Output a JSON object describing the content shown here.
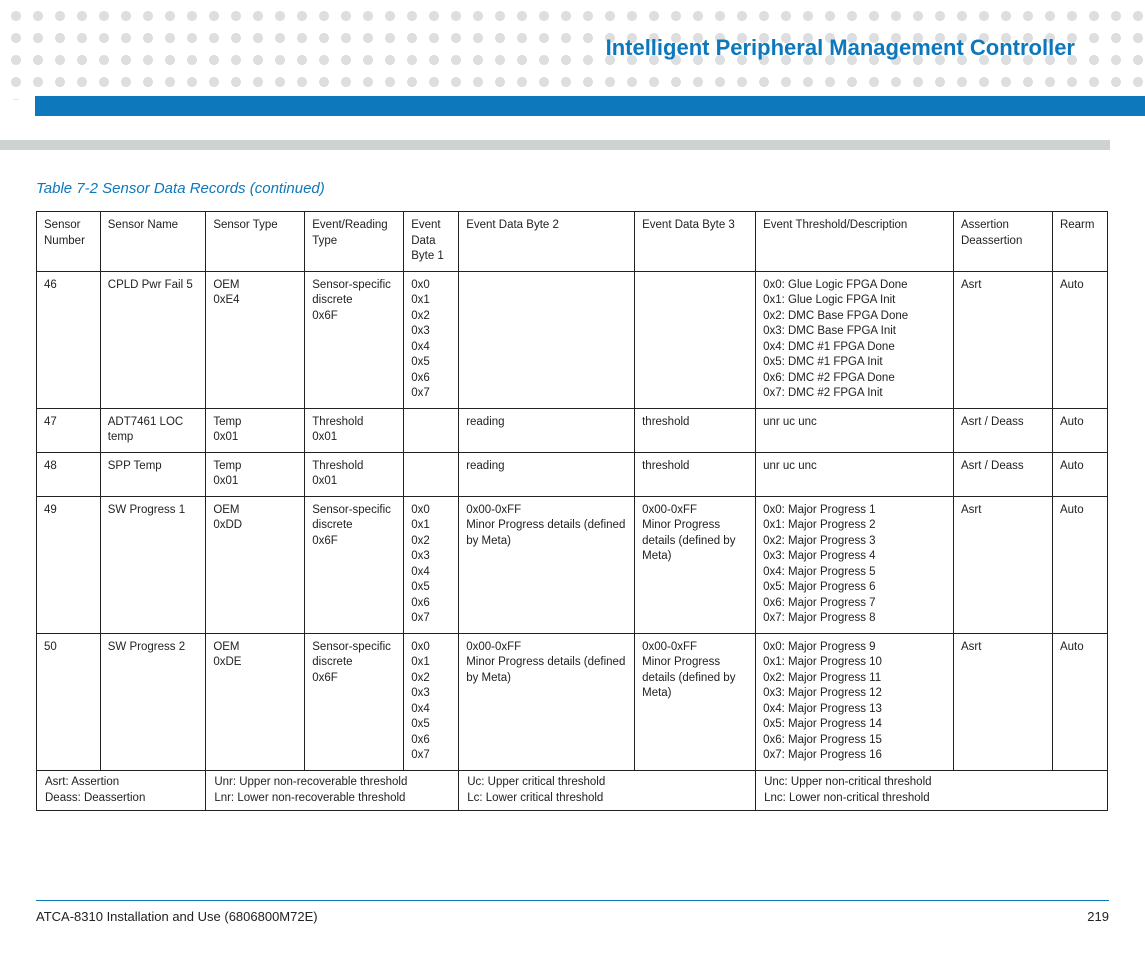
{
  "header": {
    "title": "Intelligent Peripheral Management Controller"
  },
  "caption": "Table 7-2 Sensor Data Records (continued)",
  "columns": [
    "Sensor Number",
    "Sensor Name",
    "Sensor Type",
    "Event/Reading Type",
    "Event Data Byte 1",
    "Event Data Byte 2",
    "Event Data Byte 3",
    "Event Threshold/Description",
    "Assertion Deassertion",
    "Rearm"
  ],
  "rows": [
    {
      "num": "46",
      "name": "CPLD Pwr Fail 5",
      "type": "OEM\n0xE4",
      "ert": "Sensor-specific discrete\n0x6F",
      "b1": "0x0\n0x1\n0x2\n0x3\n0x4\n0x5\n0x6\n0x7",
      "b2": "",
      "b3": "",
      "thresh": "0x0: Glue Logic FPGA Done\n0x1: Glue Logic FPGA Init\n0x2: DMC Base FPGA Done\n0x3: DMC Base FPGA Init\n0x4: DMC #1 FPGA Done\n0x5: DMC #1 FPGA Init\n0x6: DMC #2 FPGA Done\n0x7: DMC #2 FPGA Init",
      "assert": "Asrt",
      "rearm": "Auto"
    },
    {
      "num": "47",
      "name": "ADT7461 LOC temp",
      "type": "Temp\n0x01",
      "ert": "Threshold\n0x01",
      "b1": "",
      "b2": "reading",
      "b3": "threshold",
      "thresh": "unr uc unc",
      "assert": "Asrt / Deass",
      "rearm": "Auto"
    },
    {
      "num": "48",
      "name": "SPP Temp",
      "type": "Temp\n0x01",
      "ert": "Threshold\n0x01",
      "b1": "",
      "b2": "reading",
      "b3": "threshold",
      "thresh": "unr uc unc",
      "assert": "Asrt / Deass",
      "rearm": "Auto"
    },
    {
      "num": "49",
      "name": "SW Progress 1",
      "type": "OEM\n0xDD",
      "ert": "Sensor-specific discrete\n0x6F",
      "b1": "0x0\n0x1\n0x2\n0x3\n0x4\n0x5\n0x6\n0x7",
      "b2": "0x00-0xFF\nMinor Progress details (defined by Meta)",
      "b3": "0x00-0xFF\nMinor Progress details (defined by Meta)",
      "thresh": "0x0: Major Progress 1\n0x1: Major Progress 2\n0x2: Major Progress 3\n0x3: Major Progress 4\n0x4: Major Progress 5\n0x5: Major Progress 6\n0x6: Major Progress 7\n0x7: Major Progress 8",
      "assert": "Asrt",
      "rearm": "Auto"
    },
    {
      "num": "50",
      "name": "SW Progress 2",
      "type": "OEM\n0xDE",
      "ert": "Sensor-specific discrete\n0x6F",
      "b1": "0x0\n0x1\n0x2\n0x3\n0x4\n0x5\n0x6\n0x7",
      "b2": "0x00-0xFF\nMinor Progress details (defined by Meta)",
      "b3": "0x00-0xFF\nMinor Progress details (defined by Meta)",
      "thresh": "0x0: Major Progress 9\n0x1: Major Progress 10\n0x2: Major Progress 11\n0x3: Major Progress 12\n0x4: Major Progress 13\n0x5: Major Progress 14\n0x6: Major Progress 15\n0x7: Major Progress 16",
      "assert": "Asrt",
      "rearm": "Auto"
    }
  ],
  "legend": {
    "c1a": "Asrt: Assertion",
    "c1b": "Deass: Deassertion",
    "c2a": "Unr: Upper non-recoverable threshold",
    "c2b": "Lnr: Lower non-recoverable threshold",
    "c3a": "Uc: Upper critical threshold",
    "c3b": "Lc: Lower critical threshold",
    "c4a": "Unc: Upper non-critical threshold",
    "c4b": "Lnc: Lower non-critical threshold"
  },
  "footer": {
    "left": "ATCA-8310 Installation and Use (6806800M72E)",
    "right": "219"
  }
}
